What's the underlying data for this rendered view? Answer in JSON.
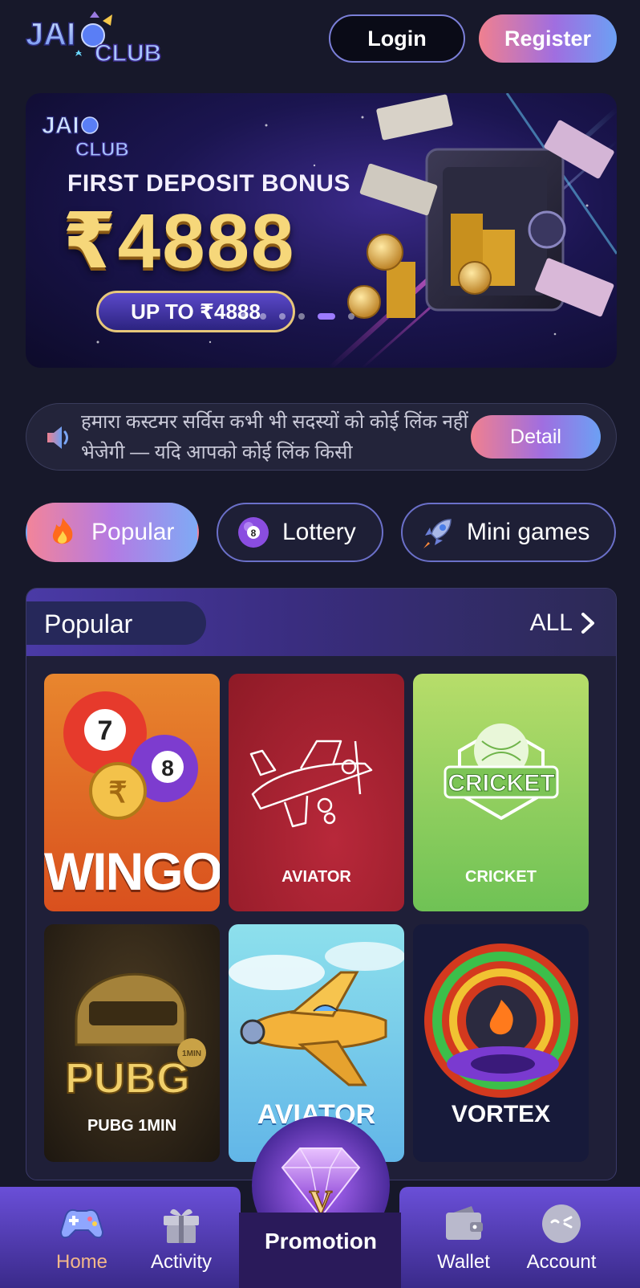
{
  "header": {
    "logo_text": "JAI CLUB",
    "login_label": "Login",
    "register_label": "Register"
  },
  "banner": {
    "logo_text": "JAI CLUB",
    "title": "FIRST DEPOSIT BONUS",
    "amount": "₹4888",
    "pill": "UP TO ₹4888",
    "slide_count": 6,
    "active_slide": 4
  },
  "notice": {
    "text": "हमारा कस्टमर सर्विस कभी भी सदस्यों को कोई लिंक नहीं भेजेगी — यदि आपको कोई लिंक किसी",
    "detail_label": "Detail",
    "icon": "speaker-icon"
  },
  "tabs": [
    {
      "label": "Popular",
      "icon": "fire-icon",
      "active": true
    },
    {
      "label": "Lottery",
      "icon": "lottery-ball-icon",
      "active": false
    },
    {
      "label": "Mini games",
      "icon": "rocket-icon",
      "active": false
    }
  ],
  "popular": {
    "title": "Popular",
    "all_label": "ALL",
    "games": [
      {
        "label": "WINGO",
        "bg": "#e8722a"
      },
      {
        "label": "AVIATOR",
        "bg": "#a3202c"
      },
      {
        "label": "CRICKET",
        "bg": "#8fcf5a"
      },
      {
        "label": "PUBG 1MIN",
        "bg": "#2a2218"
      },
      {
        "label": "AVIATOR",
        "bg": "#6fc4e6"
      },
      {
        "label": "VORTEX",
        "bg": "#171a3a"
      }
    ]
  },
  "nav": {
    "items": [
      {
        "label": "Home",
        "icon": "gamepad-icon",
        "active": true,
        "color": "#f3b88a"
      },
      {
        "label": "Activity",
        "icon": "gift-icon",
        "active": false,
        "color": "#ffffff"
      },
      {
        "label": "Promotion",
        "icon": "diamond-icon",
        "active": false,
        "color": "#ffffff"
      },
      {
        "label": "Wallet",
        "icon": "wallet-icon",
        "active": false,
        "color": "#ffffff"
      },
      {
        "label": "Account",
        "icon": "account-icon",
        "active": false,
        "color": "#ffffff"
      }
    ],
    "gem_letter": "V"
  }
}
